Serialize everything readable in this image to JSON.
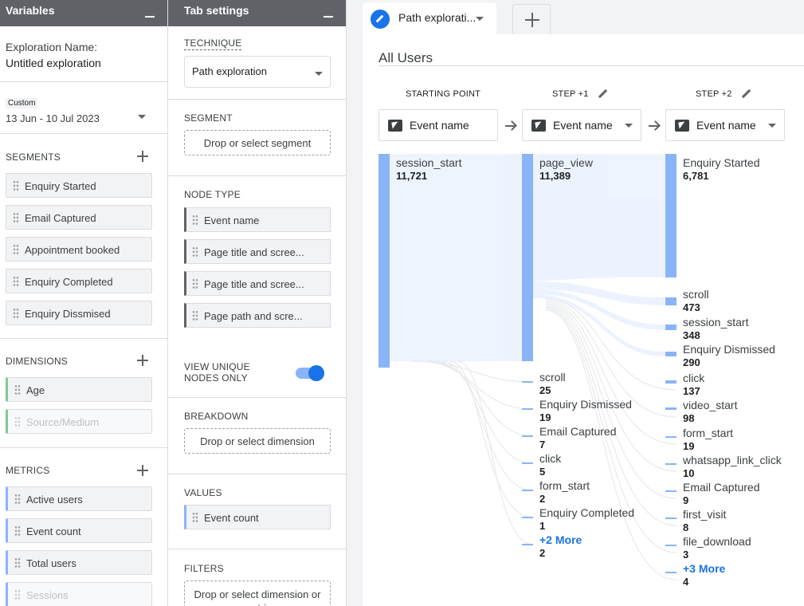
{
  "variables": {
    "title": "Variables",
    "exploration_label": "Exploration Name:",
    "exploration_value": "Untitled exploration",
    "date_badge": "Custom",
    "date_range": "13 Jun - 10 Jul 2023",
    "segments_title": "SEGMENTS",
    "segments": [
      "Enquiry Started",
      "Email Captured",
      "Appointment booked",
      "Enquiry Completed",
      "Enquiry Dissmised"
    ],
    "dimensions_title": "DIMENSIONS",
    "dimensions": [
      "Age",
      "Source/Medium"
    ],
    "metrics_title": "METRICS",
    "metrics": [
      "Active users",
      "Event count",
      "Total users",
      "Sessions"
    ]
  },
  "tab_settings": {
    "title": "Tab settings",
    "technique_label": "TECHNIQUE",
    "technique_value": "Path exploration",
    "segment_label": "SEGMENT",
    "segment_drop": "Drop or select segment",
    "node_type_label": "NODE TYPE",
    "node_types": [
      "Event name",
      "Page title and scree...",
      "Page title and scree...",
      "Page path and scre..."
    ],
    "view_unique_label": "VIEW UNIQUE NODES ONLY",
    "breakdown_label": "BREAKDOWN",
    "breakdown_drop": "Drop or select dimension",
    "values_label": "VALUES",
    "values_item": "Event count",
    "filters_label": "FILTERS",
    "filters_drop": "Drop or select dimension or metric"
  },
  "main": {
    "tab_label": "Path explorati...",
    "segment_title": "All Users",
    "steps": [
      {
        "label": "STARTING POINT",
        "box": "Event name"
      },
      {
        "label": "STEP +1",
        "box": "Event name"
      },
      {
        "label": "STEP +2",
        "box": "Event name"
      }
    ],
    "col0": [
      {
        "name": "session_start",
        "value": "11,721"
      }
    ],
    "col1": [
      {
        "name": "page_view",
        "value": "11,389"
      },
      {
        "name": "scroll",
        "value": "25"
      },
      {
        "name": "Enquiry Dismissed",
        "value": "19"
      },
      {
        "name": "Email Captured",
        "value": "7"
      },
      {
        "name": "click",
        "value": "5"
      },
      {
        "name": "form_start",
        "value": "2"
      },
      {
        "name": "Enquiry Completed",
        "value": "1"
      },
      {
        "name": "+2 More",
        "value": "2"
      }
    ],
    "col2": [
      {
        "name": "Enquiry Started",
        "value": "6,781"
      },
      {
        "name": "scroll",
        "value": "473"
      },
      {
        "name": "session_start",
        "value": "348"
      },
      {
        "name": "Enquiry Dismissed",
        "value": "290"
      },
      {
        "name": "click",
        "value": "137"
      },
      {
        "name": "video_start",
        "value": "98"
      },
      {
        "name": "form_start",
        "value": "19"
      },
      {
        "name": "whatsapp_link_click",
        "value": "10"
      },
      {
        "name": "Email Captured",
        "value": "9"
      },
      {
        "name": "first_visit",
        "value": "8"
      },
      {
        "name": "file_download",
        "value": "3"
      },
      {
        "name": "+3 More",
        "value": "4"
      }
    ],
    "accent_color": "#8ab4f8"
  }
}
